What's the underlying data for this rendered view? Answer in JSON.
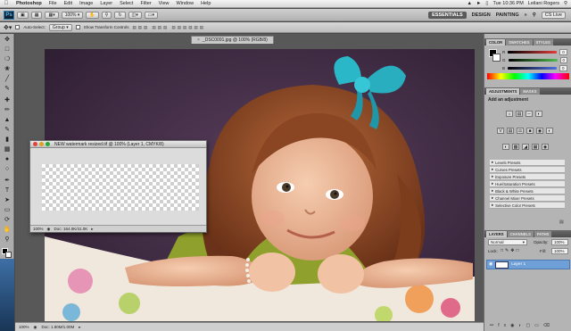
{
  "menubar": {
    "items": [
      "Photoshop",
      "File",
      "Edit",
      "Image",
      "Layer",
      "Select",
      "Filter",
      "View",
      "Window",
      "Help"
    ],
    "clock": "Tue 10:36 PM",
    "user": "Leilani Rogers"
  },
  "appbar": {
    "logo": "Ps",
    "zoom": "100%",
    "workspaces": [
      "ESSENTIALS",
      "DESIGN",
      "PAINTING"
    ],
    "active_workspace": "ESSENTIALS",
    "more": "»",
    "cs_live": "CS Live"
  },
  "options": {
    "auto_select_label": "Auto-Select:",
    "auto_select_value": "Group",
    "transform_label": "Show Transform Controls"
  },
  "document": {
    "tab_title": "_DSC0091.jpg @ 100% (RGB/8)",
    "status_zoom": "100%",
    "status_doc": "Doc: 1.80M/1.00M"
  },
  "watermark_window": {
    "title": "NEW watermark resized.tif @ 100% (Layer 1, CMYK/8)",
    "zoom": "100%",
    "doc": "Doc: 164.0K/41.0K"
  },
  "panels": {
    "color_tabs": [
      "COLOR",
      "SWATCHES",
      "STYLES"
    ],
    "color_rows": [
      {
        "label": "R",
        "value": "0",
        "bar": "#e23b3b"
      },
      {
        "label": "G",
        "value": "0",
        "bar": "#4fbf4f"
      },
      {
        "label": "B",
        "value": "0",
        "bar": "#4f6fe0"
      }
    ],
    "adjust_tabs": [
      "ADJUSTMENTS",
      "MASKS"
    ],
    "adjust_heading": "Add an adjustment",
    "presets": [
      "Levels Presets",
      "Curves Presets",
      "Exposure Presets",
      "Hue/Saturation Presets",
      "Black & White Presets",
      "Channel Mixer Presets",
      "Selective Color Presets"
    ],
    "layers_tabs": [
      "LAYERS",
      "CHANNELS",
      "PATHS"
    ],
    "blend_mode": "Normal",
    "opacity_label": "Opacity:",
    "opacity_value": "100%",
    "lock_label": "Lock:",
    "fill_label": "Fill:",
    "fill_value": "100%",
    "layer_name": "Layer 1"
  },
  "colors": {
    "accent": "#6e9fd6",
    "photo_bg": "#3e2b41",
    "bow": "#2ab7c8"
  }
}
